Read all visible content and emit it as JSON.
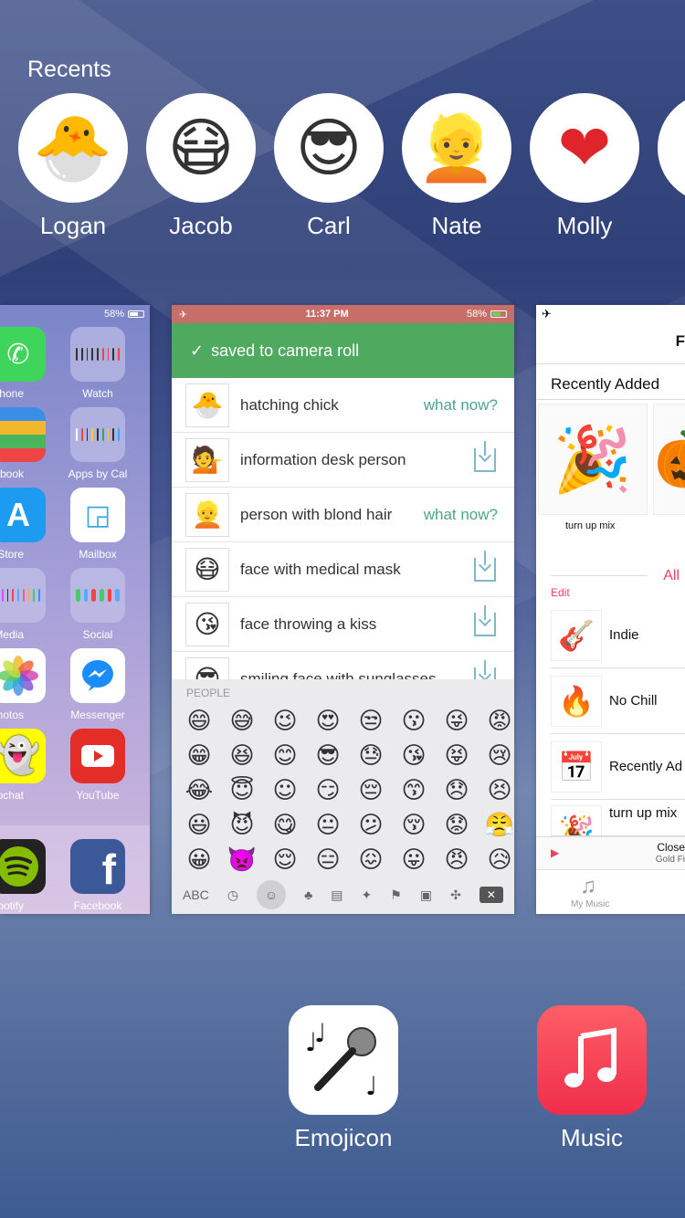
{
  "recents": {
    "title": "Recents",
    "contacts": [
      {
        "name": "Logan",
        "emoji": "🐣"
      },
      {
        "name": "Jacob",
        "emoji": "😷"
      },
      {
        "name": "Carl",
        "emoji": "😎"
      },
      {
        "name": "Nate",
        "emoji": "👱"
      },
      {
        "name": "Molly",
        "emoji": "❤"
      }
    ]
  },
  "home_card": {
    "battery": "58%",
    "apps": [
      {
        "label": "Phone"
      },
      {
        "label": "Watch"
      },
      {
        "label": "Passbook"
      },
      {
        "label": "Apps by Cal"
      },
      {
        "label": "App Store"
      },
      {
        "label": "Mailbox"
      },
      {
        "label": "Media"
      },
      {
        "label": "Social"
      },
      {
        "label": "Photos"
      },
      {
        "label": "Messenger"
      },
      {
        "label": "Snapchat"
      },
      {
        "label": "YouTube"
      },
      {
        "label": "Spotify"
      },
      {
        "label": "Facebook"
      }
    ]
  },
  "emoji_card": {
    "time": "11:37 PM",
    "battery": "58%",
    "banner": "saved to camera roll",
    "rows": [
      {
        "emoji": "🐣",
        "name": "hatching chick",
        "action": "what now?"
      },
      {
        "emoji": "💁",
        "name": "information desk person",
        "action": ""
      },
      {
        "emoji": "👱",
        "name": "person with blond hair",
        "action": "what now?"
      },
      {
        "emoji": "😷",
        "name": "face with medical mask",
        "action": ""
      },
      {
        "emoji": "😘",
        "name": "face throwing a kiss",
        "action": ""
      },
      {
        "emoji": "😎",
        "name": "smiling face with sunglasses",
        "action": ""
      }
    ],
    "keyboard": {
      "category": "PEOPLE",
      "abc": "ABC",
      "emojis": [
        "😄",
        "😅",
        "😉",
        "😍",
        "😒",
        "😗",
        "😜",
        "😡",
        "😁",
        "😆",
        "😊",
        "😎",
        "😓",
        "😘",
        "😝",
        "😢",
        "😂",
        "😇",
        "☺",
        "😏",
        "😔",
        "😙",
        "😞",
        "😣",
        "😃",
        "😈",
        "😋",
        "😐",
        "😕",
        "😚",
        "😟",
        "😤",
        "😀",
        "👿",
        "😌",
        "😑",
        "😖",
        "😛",
        "😠",
        "😥"
      ]
    }
  },
  "music_card": {
    "title": "F",
    "section": "Recently Added",
    "album_label": "turn up mix",
    "all_label": "All",
    "edit_label": "Edit",
    "playlists": [
      {
        "emoji": "🎸",
        "name": "Indie"
      },
      {
        "emoji": "🔥",
        "name": "No Chill"
      },
      {
        "emoji": "📅",
        "name": "Recently Ad"
      },
      {
        "emoji": "🎉",
        "name": "turn up mix"
      }
    ],
    "now_playing_title": "Close",
    "now_playing_artist": "Gold Fi",
    "tab_label": "My Music"
  },
  "dock_apps": [
    {
      "label": "Emojicon"
    },
    {
      "label": "Music"
    }
  ]
}
